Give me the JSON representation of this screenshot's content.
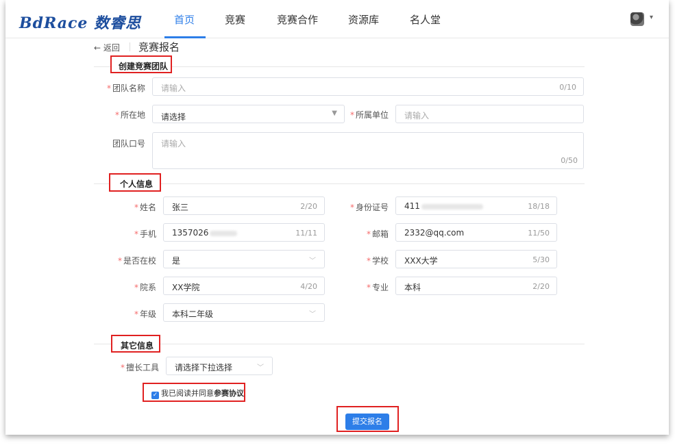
{
  "nav": {
    "logo": "BdRace 数睿思",
    "items": [
      "首页",
      "竞赛",
      "竞赛合作",
      "资源库",
      "名人堂"
    ],
    "avatar_caret": "▾"
  },
  "breadcrumb": {
    "back": "← 返回",
    "title": "竞赛报名"
  },
  "sections": {
    "team": "创建竞赛团队",
    "personal": "个人信息",
    "other": "其它信息"
  },
  "team": {
    "name_label": "团队名称",
    "name_placeholder": "请输入",
    "name_count": "0/10",
    "location_label": "所在地",
    "location_value": "请选择",
    "org_label": "所属单位",
    "org_placeholder": "请输入",
    "slogan_label": "团队口号",
    "slogan_placeholder": "请输入",
    "slogan_count": "0/50"
  },
  "personal": {
    "name_label": "姓名",
    "name_value": "张三",
    "name_count": "2/20",
    "id_label": "身份证号",
    "id_value": "411",
    "id_count": "18/18",
    "phone_label": "手机",
    "phone_value": "1357026",
    "phone_count": "11/11",
    "email_label": "邮箱",
    "email_value": "2332@qq.com",
    "email_count": "11/50",
    "inschool_label": "是否在校",
    "inschool_value": "是",
    "school_label": "学校",
    "school_value": "XXX大学",
    "school_count": "5/30",
    "dept_label": "院系",
    "dept_value": "XX学院",
    "dept_count": "4/20",
    "major_label": "专业",
    "major_value": "本科",
    "major_count": "2/20",
    "grade_label": "年级",
    "grade_value": "本科二年级"
  },
  "other": {
    "tool_label": "擅长工具",
    "tool_value": "请选择下拉选择",
    "agree_prefix": "我已阅读并同意",
    "agree_link": "参赛协议",
    "check_mark": "✓",
    "submit": "提交报名"
  },
  "colors": {
    "accent": "#2d7ee8",
    "required": "#f56c6c",
    "highlight": "#e02020"
  }
}
